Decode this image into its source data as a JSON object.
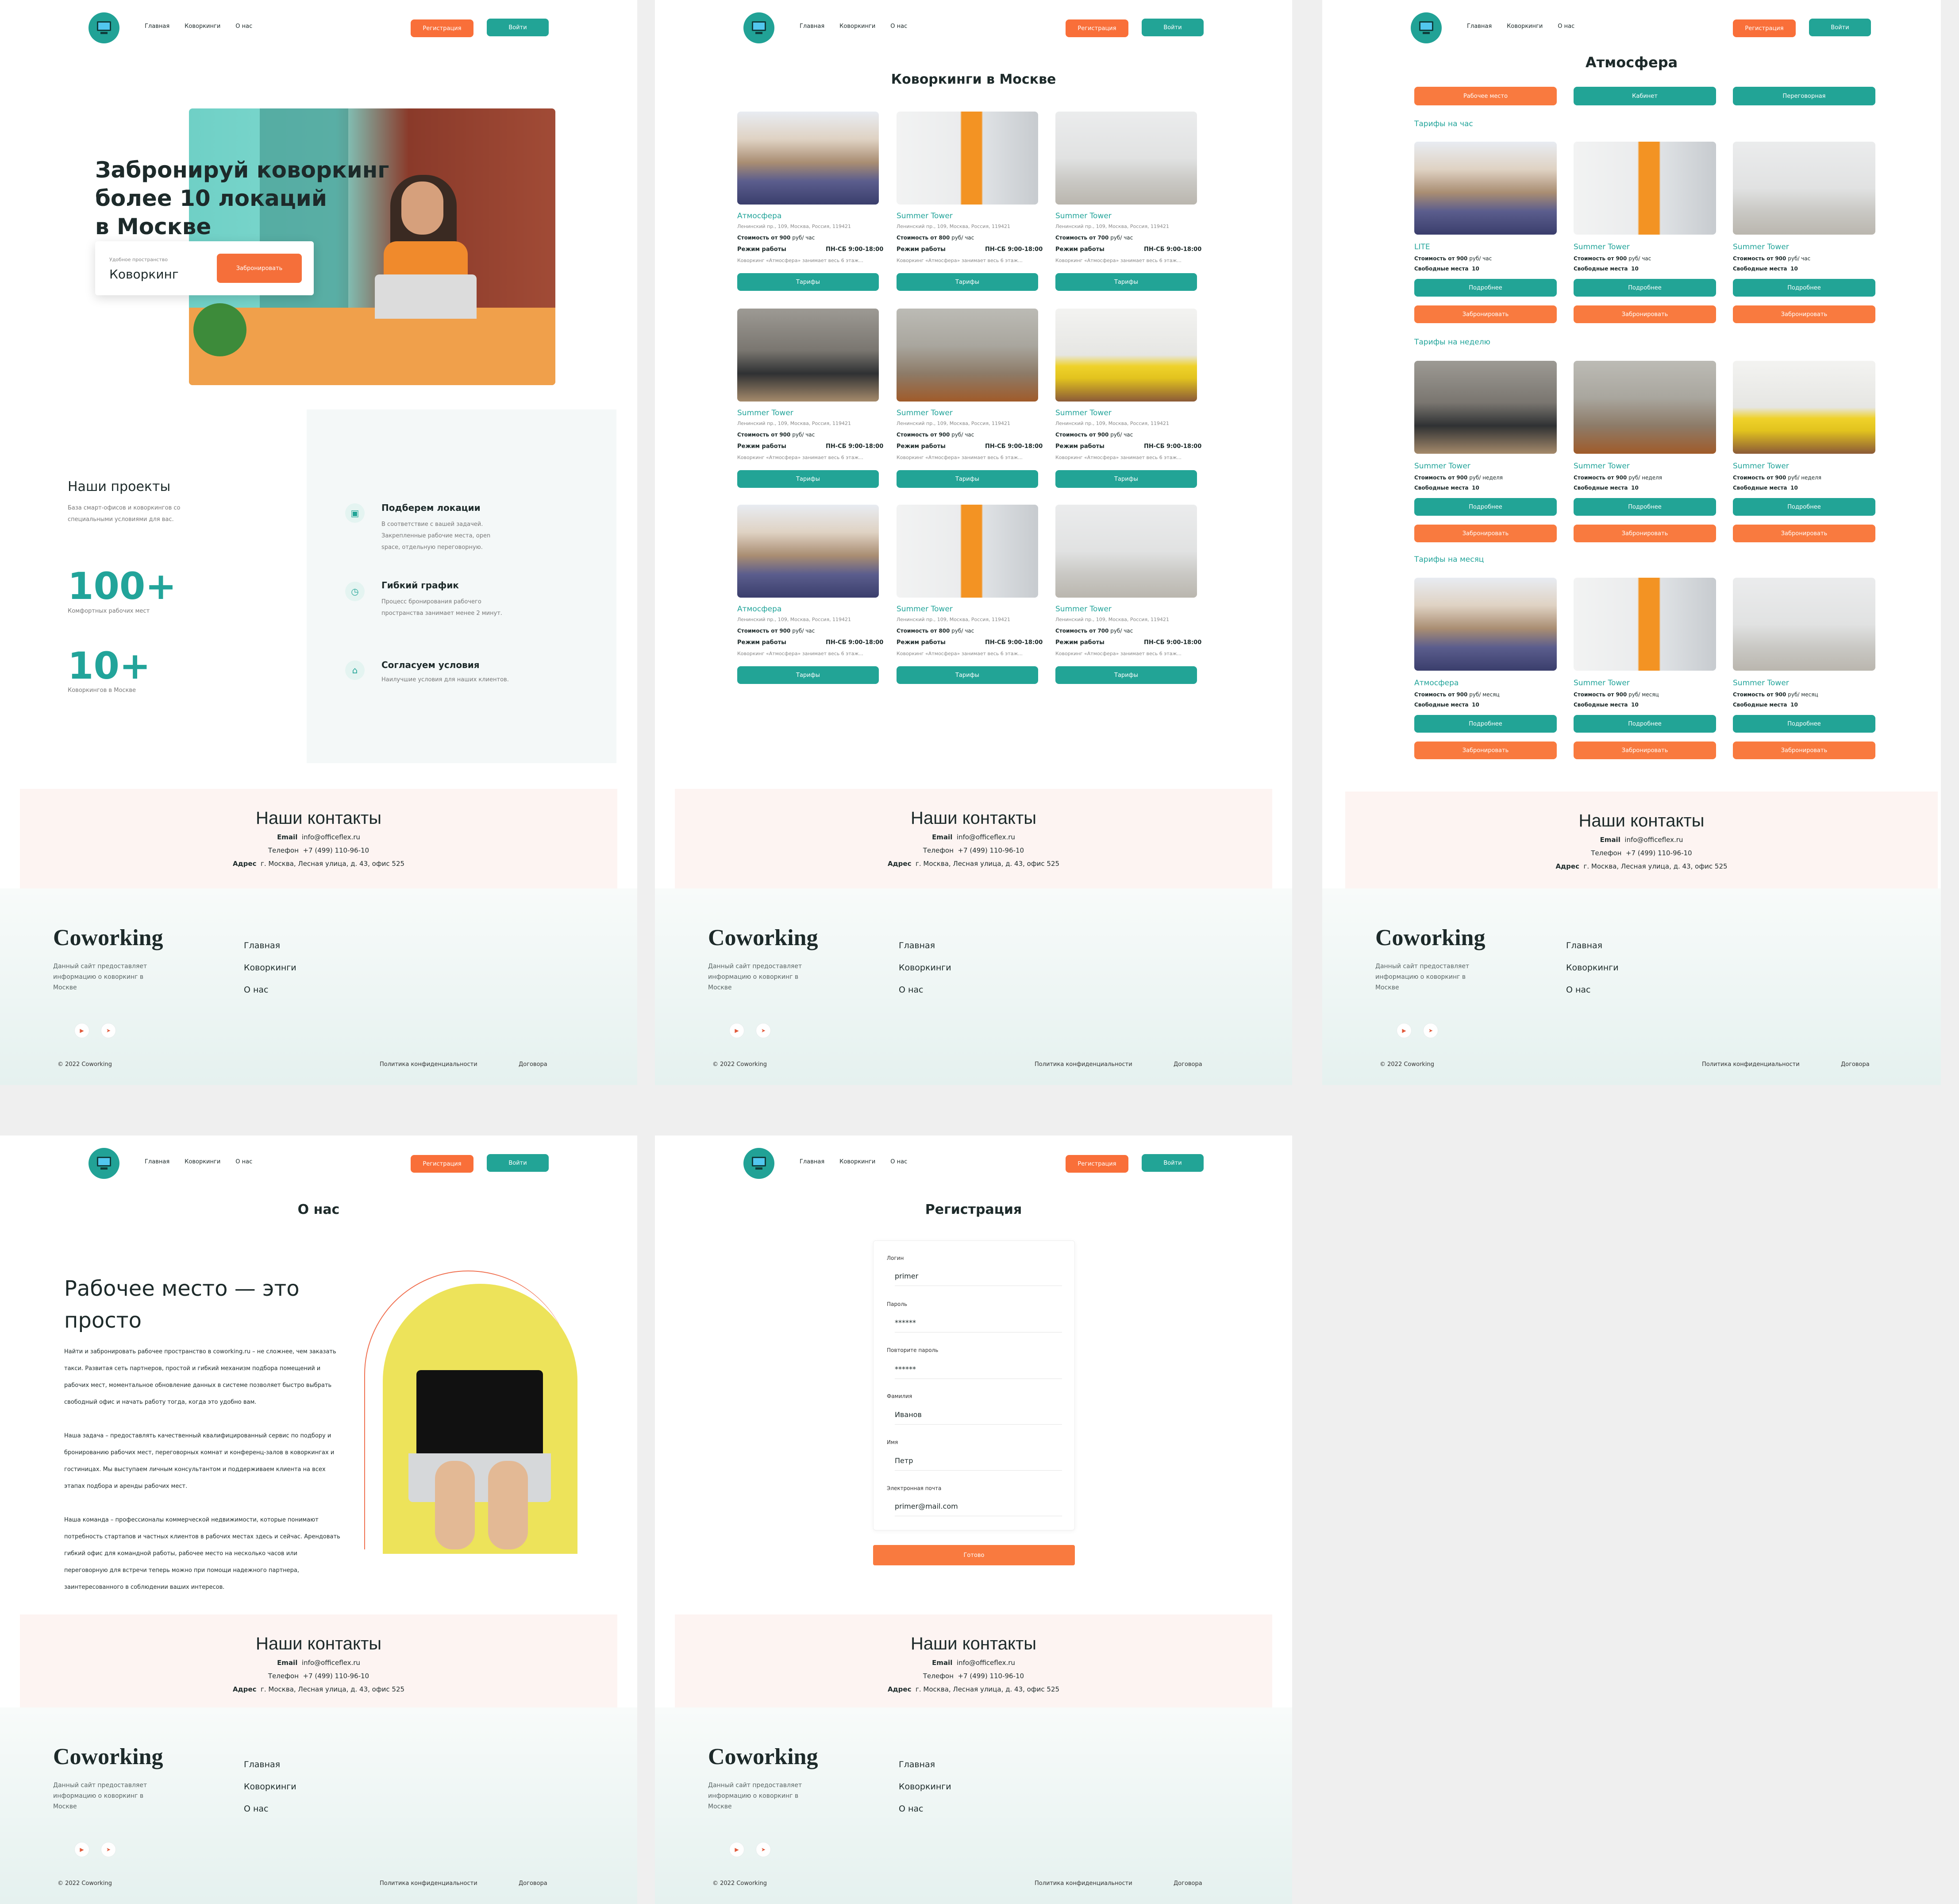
{
  "nav": {
    "home": "Главная",
    "coworkings": "Коворкинги",
    "about": "О нас",
    "register": "Регистрация",
    "login": "Войти"
  },
  "hero": {
    "title_l1": "Забронируй коворкинг",
    "title_l2": "более 10 локаций",
    "title_l3": "в Москве",
    "search_label": "Удобное пространство",
    "search_value": "Коворкинг",
    "book": "Забронировать"
  },
  "projects": {
    "title": "Наши проекты",
    "sub1": "База смарт-офисов и коворкингов со",
    "sub2": "специальными условиями для вас.",
    "stat1": "100+",
    "stat1_label": "Комфортных рабочих мест",
    "stat2": "10+",
    "stat2_label": "Коворкингов в Москве",
    "f1_title": "Подберем локации",
    "f1_l1": "В соответствие с вашей задачей.",
    "f1_l2": "Закрепленные рабочие места, open",
    "f1_l3": "space, отдельную переговорную.",
    "f2_title": "Гибкий график",
    "f2_l1": "Процесс бронирования рабочего",
    "f2_l2": "пространства занимает менее 2 минут.",
    "f3_title": "Согласуем условия",
    "f3_l1": "Наилучшие условия для наших клиентов."
  },
  "list": {
    "title": "Коворкинги в Москве",
    "address": "Ленинский пр., 109, Москва, Россия, 119421",
    "price_label": "Стоимость от",
    "price_unit": "руб/ час",
    "hours_label": "Режим работы",
    "hours": "ПН-СБ 9:00-18:00",
    "desc": "Коворкинг «Атмосфера» занимает весь 6 этаж...",
    "tariffs": "Тарифы",
    "cards": [
      {
        "name": "Атмосфера",
        "price": "900"
      },
      {
        "name": "Summer Tower",
        "price": "800"
      },
      {
        "name": "Summer Tower",
        "price": "700"
      },
      {
        "name": "Summer Tower",
        "price": "900"
      },
      {
        "name": "Summer Tower",
        "price": "900"
      },
      {
        "name": "Summer Tower",
        "price": "900"
      },
      {
        "name": "Атмосфера",
        "price": "900"
      },
      {
        "name": "Summer Tower",
        "price": "800"
      },
      {
        "name": "Summer Tower",
        "price": "700"
      }
    ]
  },
  "detail": {
    "title": "Атмосфера",
    "tab1": "Рабочее место",
    "tab2": "Кабинет",
    "tab3": "Переговорная",
    "hour": "Тарифы на час",
    "week": "Тарифы на неделю",
    "month": "Тарифы на месяц",
    "price_label": "Стоимость от",
    "unit_h": "руб/ час",
    "unit_w": "руб/ неделя",
    "unit_m": "руб/ месяц",
    "free_label": "Свободные места",
    "free": "10",
    "more": "Подробнее",
    "book": "Забронировать",
    "r1": [
      "LITE",
      "Summer Tower",
      "Summer Tower"
    ],
    "r2": [
      "Summer Tower",
      "Summer Tower",
      "Summer Tower"
    ],
    "r3": [
      "Атмосфера",
      "Summer Tower",
      "Summer Tower"
    ],
    "price": "900"
  },
  "about": {
    "title": "О нас",
    "h_l1": "Рабочее место — это",
    "h_l2": "просто",
    "p1": [
      "Найти и забронировать рабочее пространство в coworking.ru – не сложнее, чем заказать",
      "такси. Развитая сеть партнеров, простой и гибкий механизм подбора помещений и",
      "рабочих мест, моментальное обновление данных в системе позволяет быстро выбрать",
      "свободный офис и начать работу тогда, когда это удобно вам."
    ],
    "p2": [
      "Наша задача – предоставлять качественный квалифицированный сервис по подбору и",
      "бронированию рабочих мест, переговорных комнат и конференц-залов в коворкингах и",
      "гостиницах. Мы выступаем личным консультантом и поддерживаем клиента на всех",
      "этапах подбора и аренды рабочих мест."
    ],
    "p3": [
      "Наша команда – профессионалы коммерческой недвижимости, которые понимают",
      "потребность стартапов и частных клиентов в рабочих местах здесь и сейчас. Арендовать",
      "гибкий офис для командной работы, рабочее место на несколько часов или",
      "переговорную для встречи теперь можно при помощи надежного партнера,",
      "заинтересованного в соблюдении ваших интересов."
    ]
  },
  "reg": {
    "title": "Регистрация",
    "login_l": "Логин",
    "login_v": "primer",
    "pass_l": "Пароль",
    "pass_v": "******",
    "pass2_l": "Повторите пароль",
    "pass2_v": "******",
    "sur_l": "Фамилия",
    "sur_v": "Иванов",
    "name_l": "Имя",
    "name_v": "Петр",
    "mail_l": "Электронная почта",
    "mail_v": "primer@mail.com",
    "done": "Готово"
  },
  "contacts": {
    "title": "Наши контакты",
    "email_l": "Email",
    "email": "info@officeflex.ru",
    "phone_l": "Телефон",
    "phone": "+7 (499) 110-96-10",
    "addr_l": "Адрес",
    "addr": "г. Москва, Лесная улица, д. 43, офис 525"
  },
  "footer": {
    "brand": "Coworking",
    "desc": "Данный сайт предоставляет информацию о коворкинг в Москве",
    "home": "Главная",
    "cow": "Коворкинги",
    "about": "О нас",
    "copy": "© 2022 Coworking",
    "policy": "Политика конфиденциальности",
    "contracts": "Договора"
  }
}
